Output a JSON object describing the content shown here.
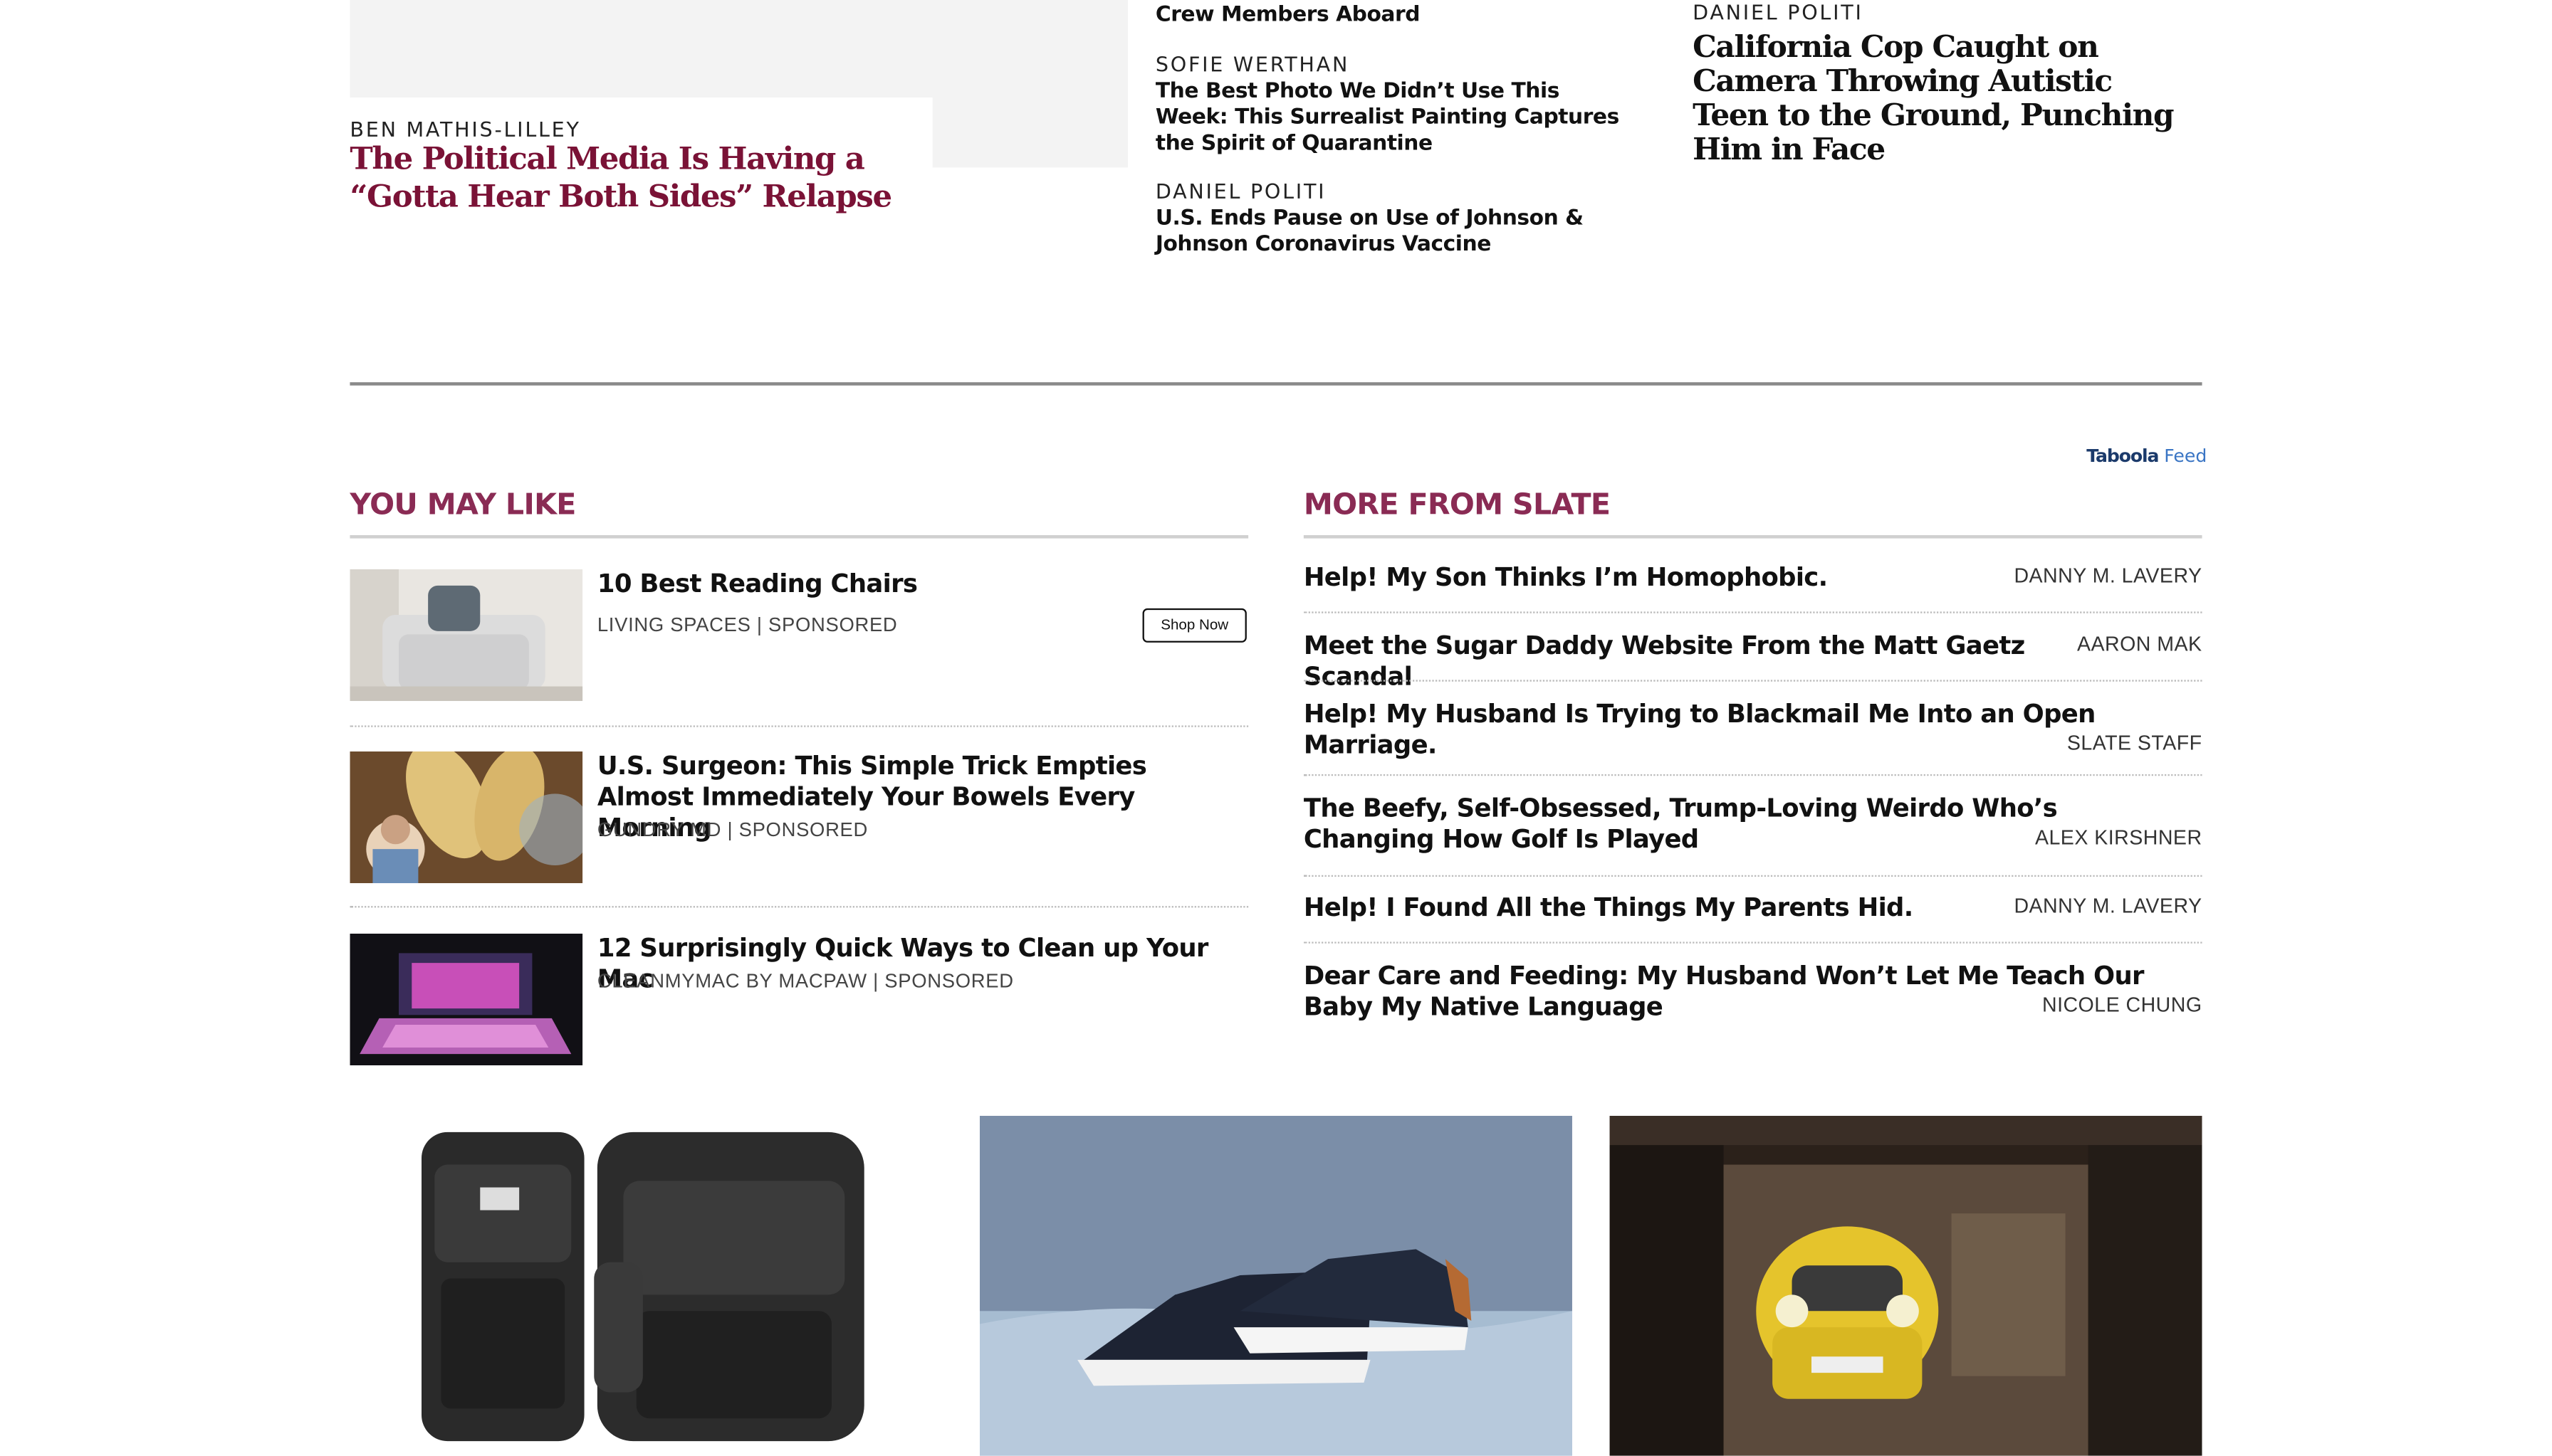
{
  "top": {
    "feature": {
      "byline": "BEN MATHIS-LILLEY",
      "headline": "The Political Media Is Having a “Gotta Hear Both Sides” Relapse"
    },
    "mid": {
      "partial_headline": "Crew Members Aboard",
      "items": [
        {
          "byline": "SOFIE WERTHAN",
          "headline": "The Best Photo We Didn’t Use This Week: This Surrealist Painting Captures the Spirit of Quarantine"
        },
        {
          "byline": "DANIEL POLITI",
          "headline": "U.S. Ends Pause on Use of Johnson & Johnson Coronavirus Vaccine"
        }
      ]
    },
    "right": {
      "byline": "DANIEL POLITI",
      "headline": "California Cop Caught on Camera Throwing Autistic Teen to the Ground, Punching Him in Face"
    }
  },
  "taboola": {
    "brand": "Taboola",
    "feed": "Feed"
  },
  "you_may_like": {
    "title": "YOU MAY LIKE",
    "items": [
      {
        "title": "10 Best Reading Chairs",
        "source": "LIVING SPACES  |  SPONSORED",
        "button": "Shop Now"
      },
      {
        "title": "U.S. Surgeon: This Simple Trick Empties Almost Immediately Your Bowels Every Morning",
        "source": "GUNDRY MD  |  SPONSORED"
      },
      {
        "title": "12 Surprisingly Quick Ways to Clean up Your Mac",
        "source": "CLEANMYMAC BY MACPAW  |  SPONSORED"
      }
    ]
  },
  "more_from_slate": {
    "title": "MORE FROM SLATE",
    "items": [
      {
        "title": "Help! My Son Thinks I’m Homophobic.",
        "author": "DANNY M. LAVERY"
      },
      {
        "title": "Meet the Sugar Daddy Website From the Matt Gaetz Scandal",
        "author": "AARON MAK"
      },
      {
        "title": "Help! My Husband Is Trying to Blackmail Me Into an Open Marriage.",
        "author": "SLATE STAFF"
      },
      {
        "title": "The Beefy, Self-Obsessed, Trump-Loving Weirdo Who’s Changing How Golf Is Played",
        "author": "ALEX KIRSHNER"
      },
      {
        "title": "Help! I Found All the Things My Parents Hid.",
        "author": "DANNY M. LAVERY"
      },
      {
        "title": "Dear Care and Feeding: My Husband Won’t Let Me Teach Our Baby My Native Language",
        "author": "NICOLE CHUNG"
      }
    ]
  },
  "colors": {
    "brand_maroon": "#7a1236",
    "section_title": "#8a2b54",
    "taboola_blue": "#3a75c4"
  }
}
